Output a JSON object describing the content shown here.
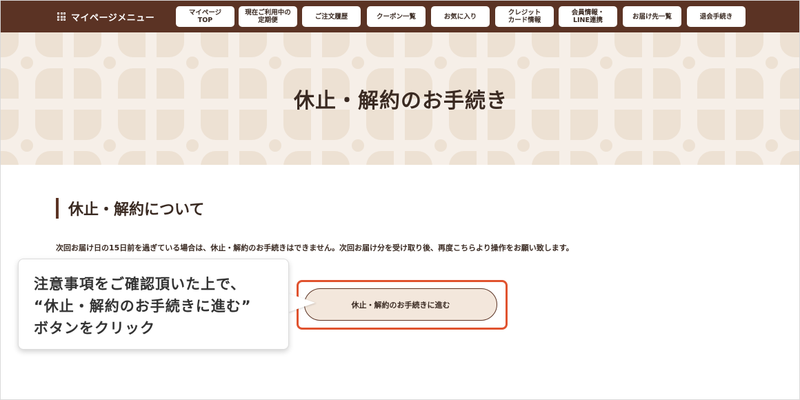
{
  "nav": {
    "menu_title": "マイページメニュー",
    "items": [
      {
        "label": "マイページ\nTOP"
      },
      {
        "label": "現在ご利用中の\n定期便"
      },
      {
        "label": "ご注文履歴"
      },
      {
        "label": "クーポン一覧"
      },
      {
        "label": "お気に入り"
      },
      {
        "label": "クレジット\nカード情報"
      },
      {
        "label": "会員情報・\nLINE連携"
      },
      {
        "label": "お届け先一覧"
      },
      {
        "label": "退会手続き"
      }
    ]
  },
  "hero": {
    "title": "休止・解約のお手続き"
  },
  "section": {
    "heading": "休止・解約について",
    "notice": "次回お届け日の15日前を過ぎている場合は、休止・解約のお手続きはできません。次回お届け分を受け取り後、再度こちらより操作をお願い致します。",
    "button_label": "休止・解約のお手続きに進む"
  },
  "callout": {
    "line1": "注意事項をご確認頂いた上で、",
    "line2": "“休止・解約のお手続きに進む”",
    "line3": "ボタンをクリック"
  },
  "colors": {
    "nav_bg": "#5b3324",
    "hero_bg": "#f6efe8",
    "button_bg": "#f3e7dc",
    "highlight": "#e0532f"
  },
  "icons": {
    "menu": "grid-icon"
  }
}
